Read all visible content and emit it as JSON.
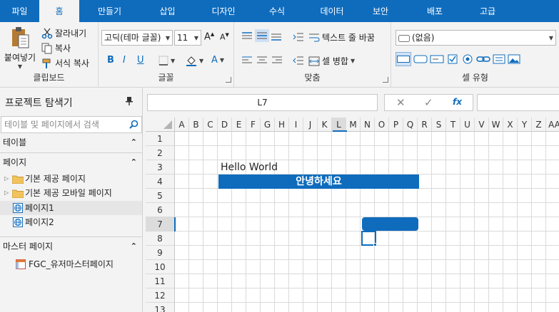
{
  "tabs": [
    "파일",
    "홈",
    "만들기",
    "삽입",
    "디자인",
    "수식",
    "데이터",
    "보안",
    "배포",
    "고급"
  ],
  "ribbon": {
    "clipboard": {
      "paste": "붙여넣기",
      "cut": "잘라내기",
      "copy": "복사",
      "format_copy": "서식 복사",
      "label": "클립보드"
    },
    "font": {
      "family": "고딕(테마 글꼴)",
      "size": "11",
      "label": "글꼴"
    },
    "align": {
      "wrap": "텍스트 줄 바꿈",
      "merge": "셀 병합",
      "label": "맞춤"
    },
    "style": {
      "cell_style": "(없음)",
      "label": "셀 유형"
    }
  },
  "explorer": {
    "title": "프로젝트 탐색기",
    "search_placeholder": "테이블 및 페이지에서 검색",
    "tables_header": "테이블",
    "pages_header": "페이지",
    "pages": [
      "기본 제공 페이지",
      "기본 제공 모바일 페이지",
      "페이지1",
      "페이지2"
    ],
    "master_header": "마스터 페이지",
    "masters": [
      "FGC_유저마스터페이지"
    ]
  },
  "namebox": "L7",
  "columns": [
    "A",
    "B",
    "C",
    "D",
    "E",
    "F",
    "G",
    "H",
    "I",
    "J",
    "K",
    "L",
    "M",
    "N",
    "O",
    "P",
    "Q",
    "R",
    "S",
    "T",
    "U",
    "V",
    "W",
    "X",
    "Y",
    "Z",
    "AA"
  ],
  "rows": [
    "1",
    "2",
    "3",
    "4",
    "5",
    "6",
    "7",
    "8",
    "9",
    "10",
    "11",
    "12",
    "13"
  ],
  "cells": {
    "hello": "Hello World",
    "banner": "안녕하세요"
  },
  "colors": {
    "accent": "#0f6cbd"
  }
}
